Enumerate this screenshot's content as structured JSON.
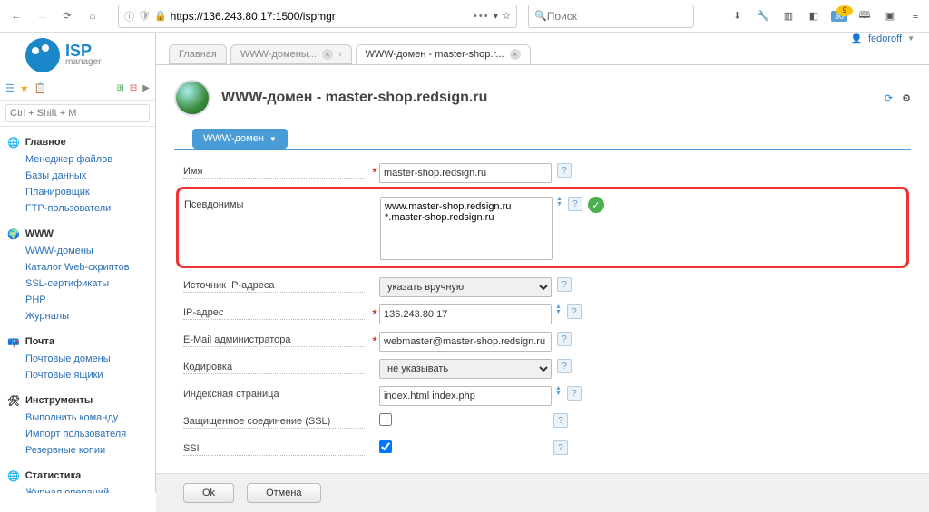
{
  "browser": {
    "url": "https://136.243.80.17:1500/ispmgr",
    "search_placeholder": "Поиск"
  },
  "user": {
    "name": "fedoroff"
  },
  "logo": {
    "brand": "ISP",
    "sub": "manager"
  },
  "side_search_placeholder": "Ctrl + Shift + M",
  "nav": {
    "g1": {
      "head": "Главное",
      "items": [
        "Менеджер файлов",
        "Базы данных",
        "Планировщик",
        "FTP-пользователи"
      ]
    },
    "g2": {
      "head": "WWW",
      "items": [
        "WWW-домены",
        "Каталог Web-скриптов",
        "SSL-сертификаты",
        "PHP",
        "Журналы"
      ]
    },
    "g3": {
      "head": "Почта",
      "items": [
        "Почтовые домены",
        "Почтовые ящики"
      ]
    },
    "g4": {
      "head": "Инструменты",
      "items": [
        "Выполнить команду",
        "Импорт пользователя",
        "Резервные копии"
      ]
    },
    "g5": {
      "head": "Статистика",
      "items": [
        "Журнал операций"
      ]
    }
  },
  "tabs": {
    "t1": "Главная",
    "t2": "WWW-домены...",
    "t3": "WWW-домен - master-shop.r..."
  },
  "page": {
    "title": "WWW-домен - master-shop.redsign.ru",
    "section": "WWW-домен"
  },
  "form": {
    "name_label": "Имя",
    "name_value": "master-shop.redsign.ru",
    "alias_label": "Псевдонимы",
    "alias_value": "www.master-shop.redsign.ru\n*.master-shop.redsign.ru",
    "ipsrc_label": "Источник IP-адреса",
    "ipsrc_value": "указать вручную",
    "ip_label": "IP-адрес",
    "ip_value": "136.243.80.17",
    "email_label": "E-Mail администратора",
    "email_value": "webmaster@master-shop.redsign.ru",
    "enc_label": "Кодировка",
    "enc_value": "не указывать",
    "index_label": "Индексная страница",
    "index_value": "index.html index.php",
    "ssl_label": "Защищенное соединение (SSL)",
    "ssi_label": "SSI"
  },
  "buttons": {
    "ok": "Ok",
    "cancel": "Отмена"
  }
}
